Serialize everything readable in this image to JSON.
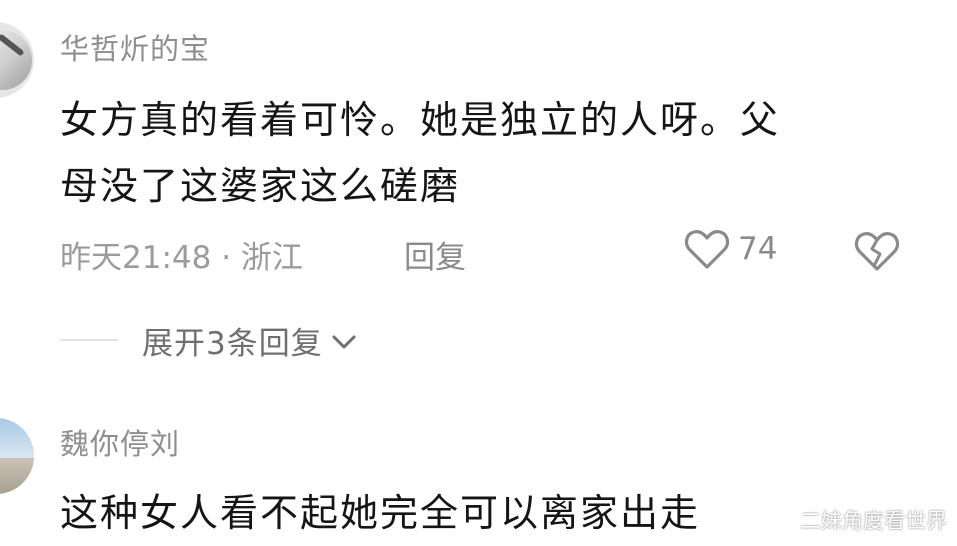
{
  "comments": [
    {
      "username": "华哲炘的宝",
      "lines": [
        "女方真的看着可怜。她是独立的人呀。父",
        "母没了这婆家这么磋磨"
      ],
      "meta": "昨天21:48 · 浙江",
      "reply_label": "回复",
      "like_count": "74",
      "expand_label": "展开3条回复"
    },
    {
      "username": "魏你停刘",
      "lines": [
        "这种女人看不起她完全可以离家出走"
      ]
    }
  ],
  "watermark": "二妹角度看世界",
  "icons": {
    "like": "heart-icon",
    "dislike": "broken-heart-icon",
    "expand": "chevron-down-icon"
  }
}
